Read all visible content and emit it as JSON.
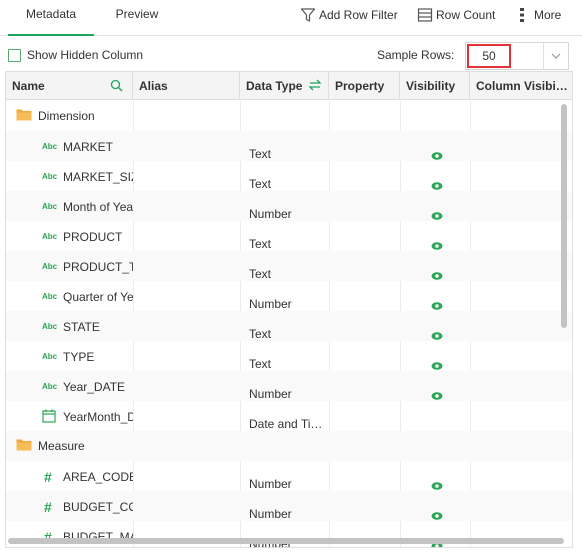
{
  "tabs": [
    {
      "label": "Metadata",
      "active": true
    },
    {
      "label": "Preview",
      "active": false
    }
  ],
  "toolbar": {
    "add_row_filter": "Add Row Filter",
    "row_count": "Row Count",
    "more": "More"
  },
  "options": {
    "show_hidden_column": "Show Hidden Column",
    "show_hidden_checked": false,
    "sample_rows_label": "Sample Rows:",
    "sample_rows_value": "50"
  },
  "columns": [
    "Name",
    "Alias",
    "Data Type",
    "Property",
    "Visibility",
    "Column Visibi…"
  ],
  "rows": [
    {
      "kind": "folder",
      "name": "Dimension"
    },
    {
      "kind": "text",
      "name": "MARKET",
      "type": "Text",
      "visible": true
    },
    {
      "kind": "text",
      "name": "MARKET_SIZE",
      "type": "Text",
      "visible": true
    },
    {
      "kind": "text",
      "name": "Month of Year",
      "type": "Number",
      "visible": true
    },
    {
      "kind": "text",
      "name": "PRODUCT",
      "type": "Text",
      "visible": true
    },
    {
      "kind": "text",
      "name": "PRODUCT_TYPE",
      "type": "Text",
      "visible": true
    },
    {
      "kind": "text",
      "name": "Quarter of Year",
      "type": "Number",
      "visible": true
    },
    {
      "kind": "text",
      "name": "STATE",
      "type": "Text",
      "visible": true
    },
    {
      "kind": "text",
      "name": "TYPE",
      "type": "Text",
      "visible": true
    },
    {
      "kind": "text",
      "name": "Year_DATE",
      "type": "Number",
      "visible": true
    },
    {
      "kind": "date",
      "name": "YearMonth_DATE",
      "type": "Date and Ti…",
      "visible": false
    },
    {
      "kind": "folder",
      "name": "Measure"
    },
    {
      "kind": "number",
      "name": "AREA_CODE",
      "type": "Number",
      "visible": true
    },
    {
      "kind": "number",
      "name": "BUDGET_COGS",
      "type": "Number",
      "visible": true
    },
    {
      "kind": "number",
      "name": "BUDGET_MARGIN",
      "type": "Number",
      "visible": true
    }
  ],
  "colors": {
    "accent": "#1aa55e",
    "highlight": "#e0343a",
    "folder": "#f0a93b"
  },
  "icons": [
    "filter-icon",
    "row-count-icon",
    "more-icon",
    "search-icon",
    "swap-icon",
    "folder-icon",
    "abc-icon",
    "hash-icon",
    "calendar-icon",
    "eye-icon",
    "chevron-down-icon"
  ]
}
